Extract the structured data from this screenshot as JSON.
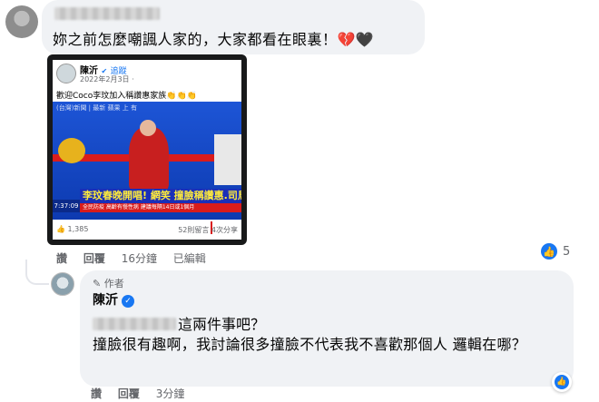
{
  "comment1": {
    "text": "妳之前怎麼嘲諷人家的，大家都看在眼裏！💔🖤"
  },
  "attachment": {
    "post_name": "陳沂",
    "post_follow": "追蹤",
    "post_date": "2022年2月3日 ·",
    "post_caption": "歡迎Coco李玟加入稱讚惠家族👏👏👏",
    "tv_status": "(台灣)新聞 | 最新 蘋果 上 有",
    "tv_headline": "李玟春晚開唱! 網笑 撞臉稱讚惠.司馬玉嬌",
    "tv_ticker": "全民防疫 高齡有慢性病 建議每隔14日或1個月",
    "tv_clock": "7:37:09",
    "post_likes": "1,385",
    "post_counts": "52則留言  4次分享"
  },
  "comment1_actions": {
    "like": "讚",
    "reply": "回覆",
    "time": "16分鐘",
    "edited": "已編輯"
  },
  "comment1_reactions": {
    "count": "5",
    "color": "#1877f2"
  },
  "reply": {
    "author_tag": "作者",
    "name": "陳沂",
    "line1": "這兩件事吧？",
    "line2": "撞臉很有趣啊，我討論很多撞臉不代表我不喜歡那個人 邏輯在哪？"
  },
  "reply_actions": {
    "like": "讚",
    "reply": "回覆",
    "time": "3分鐘"
  }
}
